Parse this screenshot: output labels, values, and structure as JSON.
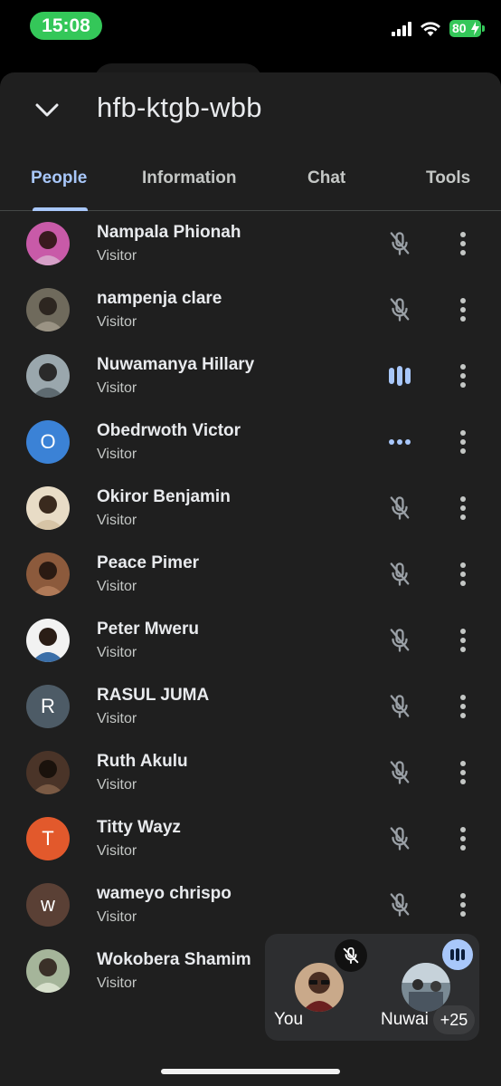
{
  "status": {
    "time": "15:08",
    "battery": "80"
  },
  "meeting": {
    "code": "hfb-ktgb-wbb"
  },
  "tabs": [
    {
      "label": "People",
      "active": true
    },
    {
      "label": "Information",
      "active": false
    },
    {
      "label": "Chat",
      "active": false
    },
    {
      "label": "Tools",
      "active": false
    }
  ],
  "participants": [
    {
      "name": "Nampala Phionah",
      "role": "Visitor",
      "mic": "muted",
      "avatar": "photo"
    },
    {
      "name": "nampenja clare",
      "role": "Visitor",
      "mic": "muted",
      "avatar": "photo"
    },
    {
      "name": "Nuwamanya Hillary",
      "role": "Visitor",
      "mic": "speaking",
      "avatar": "photo"
    },
    {
      "name": "Obedrwoth Victor",
      "role": "Visitor",
      "mic": "idle",
      "avatar": "letter",
      "initial": "O",
      "color": "#3b82d6"
    },
    {
      "name": "Okiror Benjamin",
      "role": "Visitor",
      "mic": "muted",
      "avatar": "photo"
    },
    {
      "name": "Peace Pimer",
      "role": "Visitor",
      "mic": "muted",
      "avatar": "photo"
    },
    {
      "name": "Peter Mweru",
      "role": "Visitor",
      "mic": "muted",
      "avatar": "photo"
    },
    {
      "name": "RASUL JUMA",
      "role": "Visitor",
      "mic": "muted",
      "avatar": "letter",
      "initial": "R",
      "color": "#4d5b66"
    },
    {
      "name": "Ruth Akulu",
      "role": "Visitor",
      "mic": "muted",
      "avatar": "photo"
    },
    {
      "name": "Titty Wayz",
      "role": "Visitor",
      "mic": "muted",
      "avatar": "letter",
      "initial": "T",
      "color": "#e2592c"
    },
    {
      "name": "wameyo chrispo",
      "role": "Visitor",
      "mic": "muted",
      "avatar": "letter",
      "initial": "w",
      "color": "#5a4035"
    },
    {
      "name": "Wokobera Shamim",
      "role": "Visitor",
      "mic": "none",
      "avatar": "photo"
    }
  ],
  "pip": {
    "self_label": "You",
    "other_label": "Nuwai",
    "overflow": "+25"
  },
  "colors": {
    "accent": "#a8c7fa",
    "sheet": "#1f1f1f",
    "status_green": "#34c759"
  }
}
